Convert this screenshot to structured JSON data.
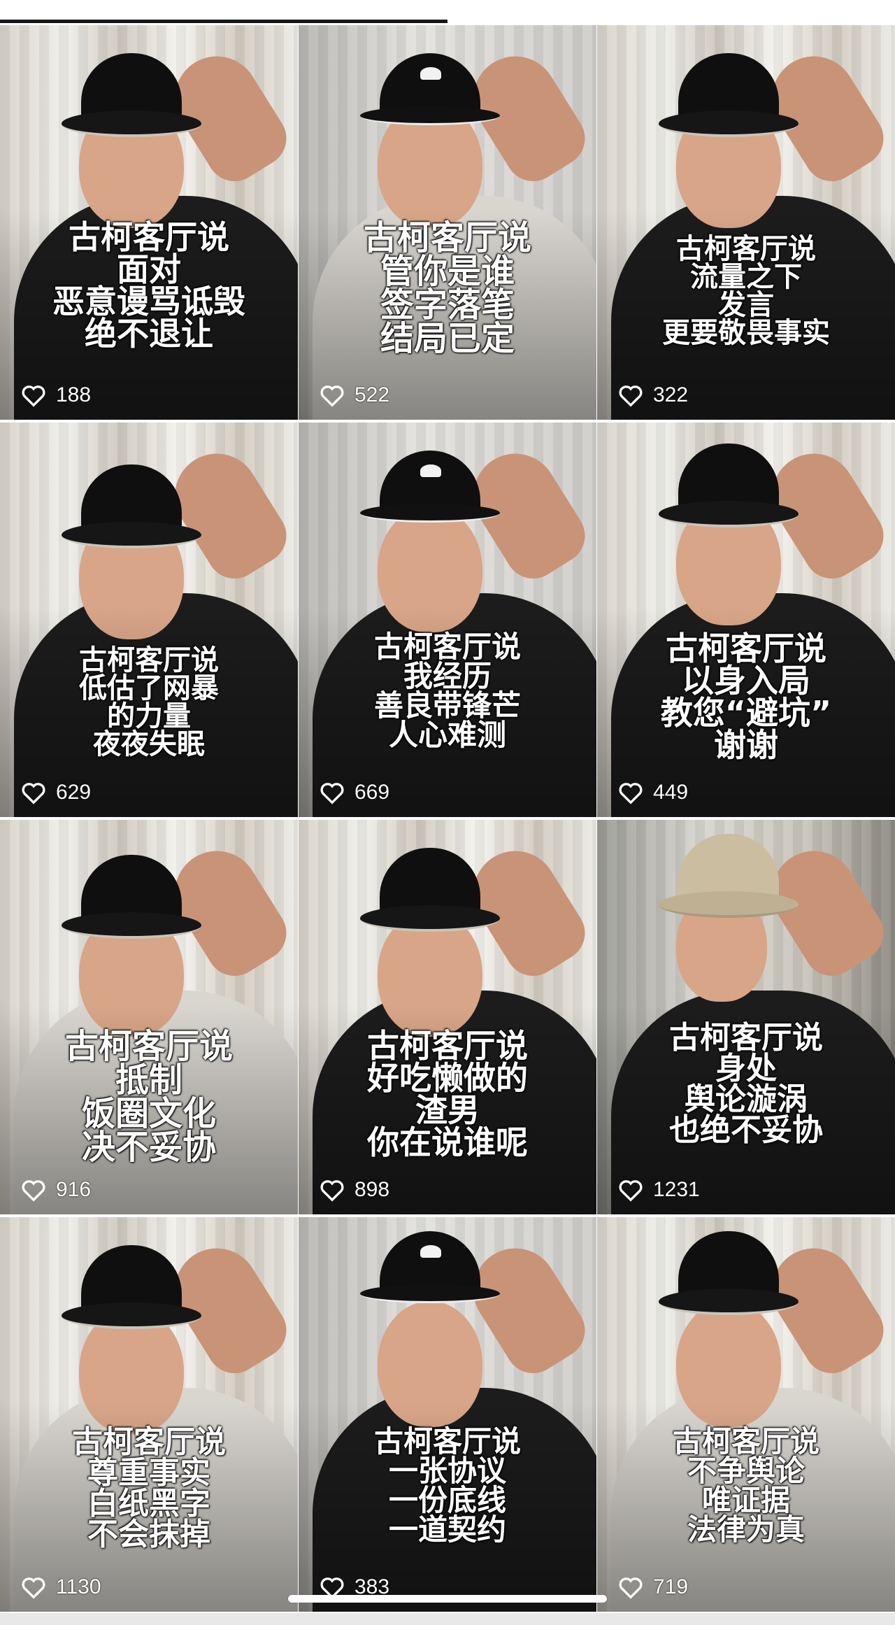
{
  "tiles": [
    {
      "caption": [
        "古柯客厅说",
        "面对",
        "恶意谩骂诋毁",
        "绝不退让"
      ],
      "likes": "188"
    },
    {
      "caption": [
        "古柯客厅说",
        "管你是谁",
        "签字落笔",
        "结局已定"
      ],
      "likes": "522"
    },
    {
      "caption": [
        "古柯客厅说",
        "流量之下",
        "发言",
        "更要敬畏事实"
      ],
      "likes": "322"
    },
    {
      "caption": [
        "古柯客厅说",
        "低估了网暴",
        "的力量",
        "夜夜失眠"
      ],
      "likes": "629"
    },
    {
      "caption": [
        "古柯客厅说",
        "我经历",
        "善良带锋芒",
        "人心难测"
      ],
      "likes": "669"
    },
    {
      "caption": [
        "古柯客厅说",
        "以身入局",
        "教您“避坑”",
        "谢谢"
      ],
      "likes": "449"
    },
    {
      "caption": [
        "古柯客厅说",
        "抵制",
        "饭圈文化",
        "决不妥协"
      ],
      "likes": "916"
    },
    {
      "caption": [
        "古柯客厅说",
        "好吃懒做的",
        "渣男",
        "你在说谁呢"
      ],
      "likes": "898"
    },
    {
      "caption": [
        "古柯客厅说",
        "身处",
        "舆论漩涡",
        "也绝不妥协"
      ],
      "likes": "1231"
    },
    {
      "caption": [
        "古柯客厅说",
        "尊重事实",
        "白纸黑字",
        "不会抹掉"
      ],
      "likes": "1130"
    },
    {
      "caption": [
        "古柯客厅说",
        "一张协议",
        "一份底线",
        "一道契约"
      ],
      "likes": "383"
    },
    {
      "caption": [
        "古柯客厅说",
        "不争舆论",
        "唯证据",
        "法律为真"
      ],
      "likes": "719"
    }
  ],
  "icons": {
    "like": "heart-outline-icon"
  }
}
